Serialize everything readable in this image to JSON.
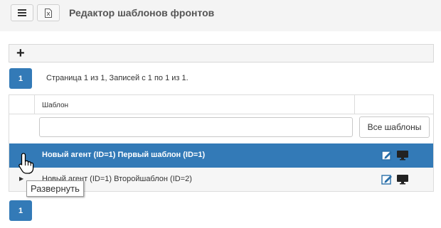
{
  "header": {
    "title": "Редактор шаблонов фронтов",
    "menu_icon": "hamburger-icon",
    "excel_icon": "excel-export-icon"
  },
  "toolbar": {
    "add_label": "+"
  },
  "pagination": {
    "current_page": "1",
    "info": "Страница 1 из 1, Записей с 1 по 1 из 1."
  },
  "grid": {
    "column_header": "Шаблон",
    "filter": {
      "value": "",
      "placeholder": ""
    },
    "all_button_label": "Все шаблоны",
    "rows": [
      {
        "label": "Новый агент (ID=1) Первый шаблон (ID=1)",
        "selected": true
      },
      {
        "label": "Новый агент (ID=1) Второйшаблон (ID=2)",
        "selected": false
      }
    ]
  },
  "tooltip": {
    "text": "Развернуть"
  },
  "colors": {
    "accent": "#337ab7",
    "selected_row": "#337ab7",
    "title_text": "#555555"
  }
}
